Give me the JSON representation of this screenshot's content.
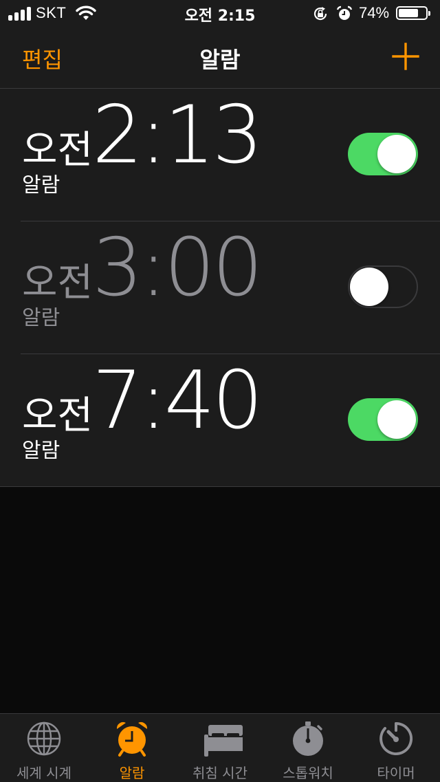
{
  "status_bar": {
    "carrier": "SKT",
    "time": "오전 2:15",
    "battery_percent": "74%",
    "battery_level": 0.74,
    "icons": [
      "signal-icon",
      "wifi-icon",
      "rotation-lock-icon",
      "alarm-icon",
      "battery-icon"
    ]
  },
  "nav": {
    "edit_label": "편집",
    "title": "알람",
    "add_icon": "plus-icon"
  },
  "alarms": [
    {
      "ampm": "오전",
      "time": "2:13",
      "label": "알람",
      "enabled": true
    },
    {
      "ampm": "오전",
      "time": "3:00",
      "label": "알람",
      "enabled": false
    },
    {
      "ampm": "오전",
      "time": "7:40",
      "label": "알람",
      "enabled": true
    }
  ],
  "tabs": [
    {
      "label": "세계 시계",
      "icon": "globe-icon",
      "active": false
    },
    {
      "label": "알람",
      "icon": "alarm-clock-icon",
      "active": true
    },
    {
      "label": "취침 시간",
      "icon": "bed-icon",
      "active": false
    },
    {
      "label": "스톱워치",
      "icon": "stopwatch-icon",
      "active": false
    },
    {
      "label": "타이머",
      "icon": "timer-icon",
      "active": false
    }
  ],
  "colors": {
    "accent": "#ff9500",
    "toggle_on": "#4cd964",
    "background": "#1c1c1c",
    "inactive_text": "#8e8e93"
  }
}
